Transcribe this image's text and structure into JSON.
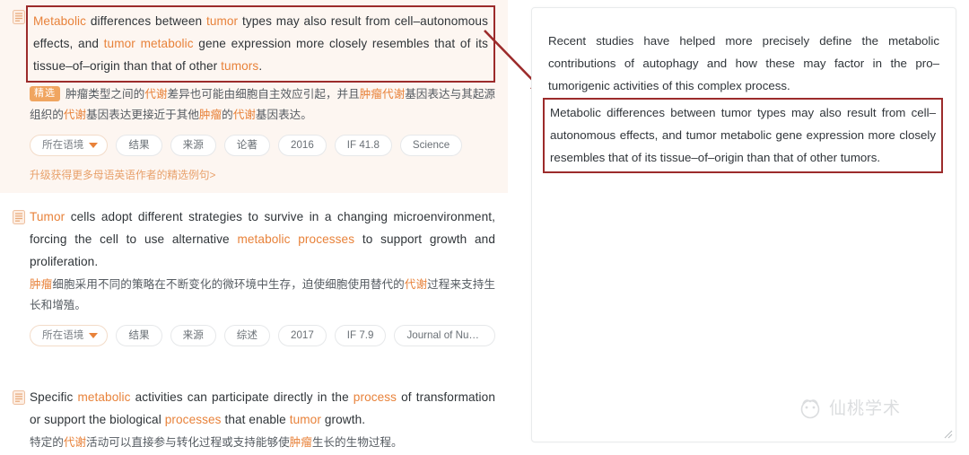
{
  "colors": {
    "highlight_term": "#e8823a",
    "box_border": "#9c2b2b",
    "featured_bg": "#fdf6f1",
    "badge_bg": "#f0a560",
    "link": "#e8a06a",
    "tag_border": "#e6e8ea",
    "body_text": "#2f3438"
  },
  "left_pane": {
    "entries": [
      {
        "icon": "document-icon",
        "featured": true,
        "boxed": true,
        "sentence_parts": [
          {
            "text": "Metabolic",
            "highlight": true
          },
          {
            "text": " differences between ",
            "highlight": false
          },
          {
            "text": "tumor",
            "highlight": true
          },
          {
            "text": " types may also result from cell–autonomous effects, and ",
            "highlight": false
          },
          {
            "text": "tumor metabolic",
            "highlight": true
          },
          {
            "text": " gene expression more closely resembles that of its tissue–of–origin than that of other ",
            "highlight": false
          },
          {
            "text": "tumors",
            "highlight": true
          },
          {
            "text": ".",
            "highlight": false
          }
        ],
        "translation_badge": "精选",
        "translation_parts": [
          {
            "text": "肿瘤类型之间的",
            "highlight": false
          },
          {
            "text": "代谢",
            "highlight": true
          },
          {
            "text": "差异也可能由细胞自主效应引起，并且",
            "highlight": false
          },
          {
            "text": "肿瘤代谢",
            "highlight": true
          },
          {
            "text": "基因表达与其起源组织的",
            "highlight": false
          },
          {
            "text": "代谢",
            "highlight": true
          },
          {
            "text": "基因表达更接近于其他",
            "highlight": false
          },
          {
            "text": "肿瘤",
            "highlight": true
          },
          {
            "text": "的",
            "highlight": false
          },
          {
            "text": "代谢",
            "highlight": true
          },
          {
            "text": "基因表达。",
            "highlight": false
          }
        ],
        "tags": {
          "context_label": "所在语境",
          "items": [
            "结果",
            "来源",
            "论著",
            "2016",
            "IF 41.8",
            "Science"
          ]
        },
        "upgrade_link": "升级获得更多母语英语作者的精选例句>"
      },
      {
        "icon": "document-icon",
        "featured": false,
        "boxed": false,
        "sentence_parts": [
          {
            "text": "Tumor",
            "highlight": true
          },
          {
            "text": " cells adopt different strategies to survive in a changing microenvironment, forcing the cell to use alternative ",
            "highlight": false
          },
          {
            "text": "metabolic processes",
            "highlight": true
          },
          {
            "text": " to support growth and proliferation.",
            "highlight": false
          }
        ],
        "translation_badge": "",
        "translation_parts": [
          {
            "text": "肿瘤",
            "highlight": true
          },
          {
            "text": "细胞采用不同的策略在不断变化的微环境中生存，迫使细胞使用替代的",
            "highlight": false
          },
          {
            "text": "代谢",
            "highlight": true
          },
          {
            "text": "过程来支持生长和增殖。",
            "highlight": false
          }
        ],
        "tags": {
          "context_label": "所在语境",
          "items": [
            "结果",
            "来源",
            "综述",
            "2017",
            "IF 7.9",
            "Journal of Nuclea..."
          ]
        },
        "upgrade_link": ""
      },
      {
        "icon": "document-icon",
        "featured": false,
        "boxed": false,
        "sentence_parts": [
          {
            "text": "Specific ",
            "highlight": false
          },
          {
            "text": "metabolic",
            "highlight": true
          },
          {
            "text": " activities can participate directly in the ",
            "highlight": false
          },
          {
            "text": "process",
            "highlight": true
          },
          {
            "text": " of transformation or support the biological ",
            "highlight": false
          },
          {
            "text": "processes",
            "highlight": true
          },
          {
            "text": " that enable ",
            "highlight": false
          },
          {
            "text": "tumor",
            "highlight": true
          },
          {
            "text": " growth.",
            "highlight": false
          }
        ],
        "translation_badge": "",
        "translation_parts": [
          {
            "text": "特定的",
            "highlight": false
          },
          {
            "text": "代谢",
            "highlight": true
          },
          {
            "text": "活动可以直接参与转化过程或支持能够使",
            "highlight": false
          },
          {
            "text": "肿瘤",
            "highlight": true
          },
          {
            "text": "生长的生物过程。",
            "highlight": false
          }
        ],
        "tags": null,
        "upgrade_link": ""
      }
    ]
  },
  "annotation": {
    "arrow": "arrow-pointer-icon"
  },
  "right_pane": {
    "paragraphs": [
      {
        "text": "Recent studies have helped more precisely define the metabolic contributions of autophagy and how these may factor in the pro–tumorigenic activities of this complex process.",
        "boxed": false
      },
      {
        "text": "Metabolic differences between tumor types may also result from cell–autonomous effects, and tumor metabolic gene expression more closely resembles that of its tissue–of–origin than that of other tumors.",
        "boxed": true
      }
    ],
    "resize_handle": "resize-grip-icon"
  },
  "watermark": {
    "logo": "peach-logo-icon",
    "text": "仙桃学术"
  }
}
